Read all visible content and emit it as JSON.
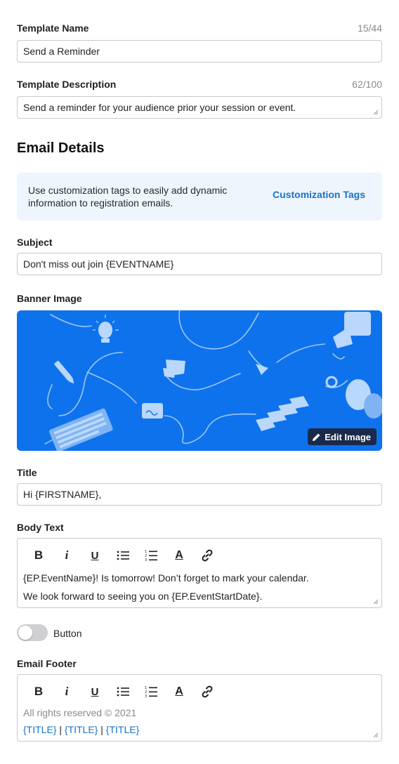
{
  "template_name": {
    "label": "Template Name",
    "counter": "15/44",
    "value": "Send a Reminder"
  },
  "template_description": {
    "label": "Template Description",
    "counter": "62/100",
    "value": "Send a reminder for your audience prior your session or event."
  },
  "email_details": {
    "heading": "Email Details",
    "info_text": "Use customization tags to easily add dynamic information to registration emails.",
    "info_link": "Customization Tags"
  },
  "subject": {
    "label": "Subject",
    "value": "Don't miss out join {EVENTNAME}"
  },
  "banner": {
    "label": "Banner Image",
    "edit_label": "Edit Image",
    "background_color": "#0e72ed"
  },
  "title_field": {
    "label": "Title",
    "value": "Hi {FIRSTNAME},"
  },
  "body_text": {
    "label": "Body Text",
    "line1": "{EP.EventName}! Is tomorrow! Don’t forget to mark your calendar.",
    "line2": "We look forward to seeing you on {EP.EventStartDate}."
  },
  "toolbar": {
    "bold": "B",
    "italic": "i",
    "underline": "U",
    "font_color": "A"
  },
  "button_toggle": {
    "label": "Button",
    "on": false
  },
  "email_footer": {
    "label": "Email Footer",
    "copyright": "All rights reserved © 2021",
    "link1": "{TITLE}",
    "sep1": "|",
    "link2": "{TITLE}",
    "sep2": "|",
    "link3": "{TITLE}"
  },
  "colors": {
    "accent": "#1a73c8",
    "banner": "#0e72ed",
    "edit_button": "#1b2a4a"
  }
}
